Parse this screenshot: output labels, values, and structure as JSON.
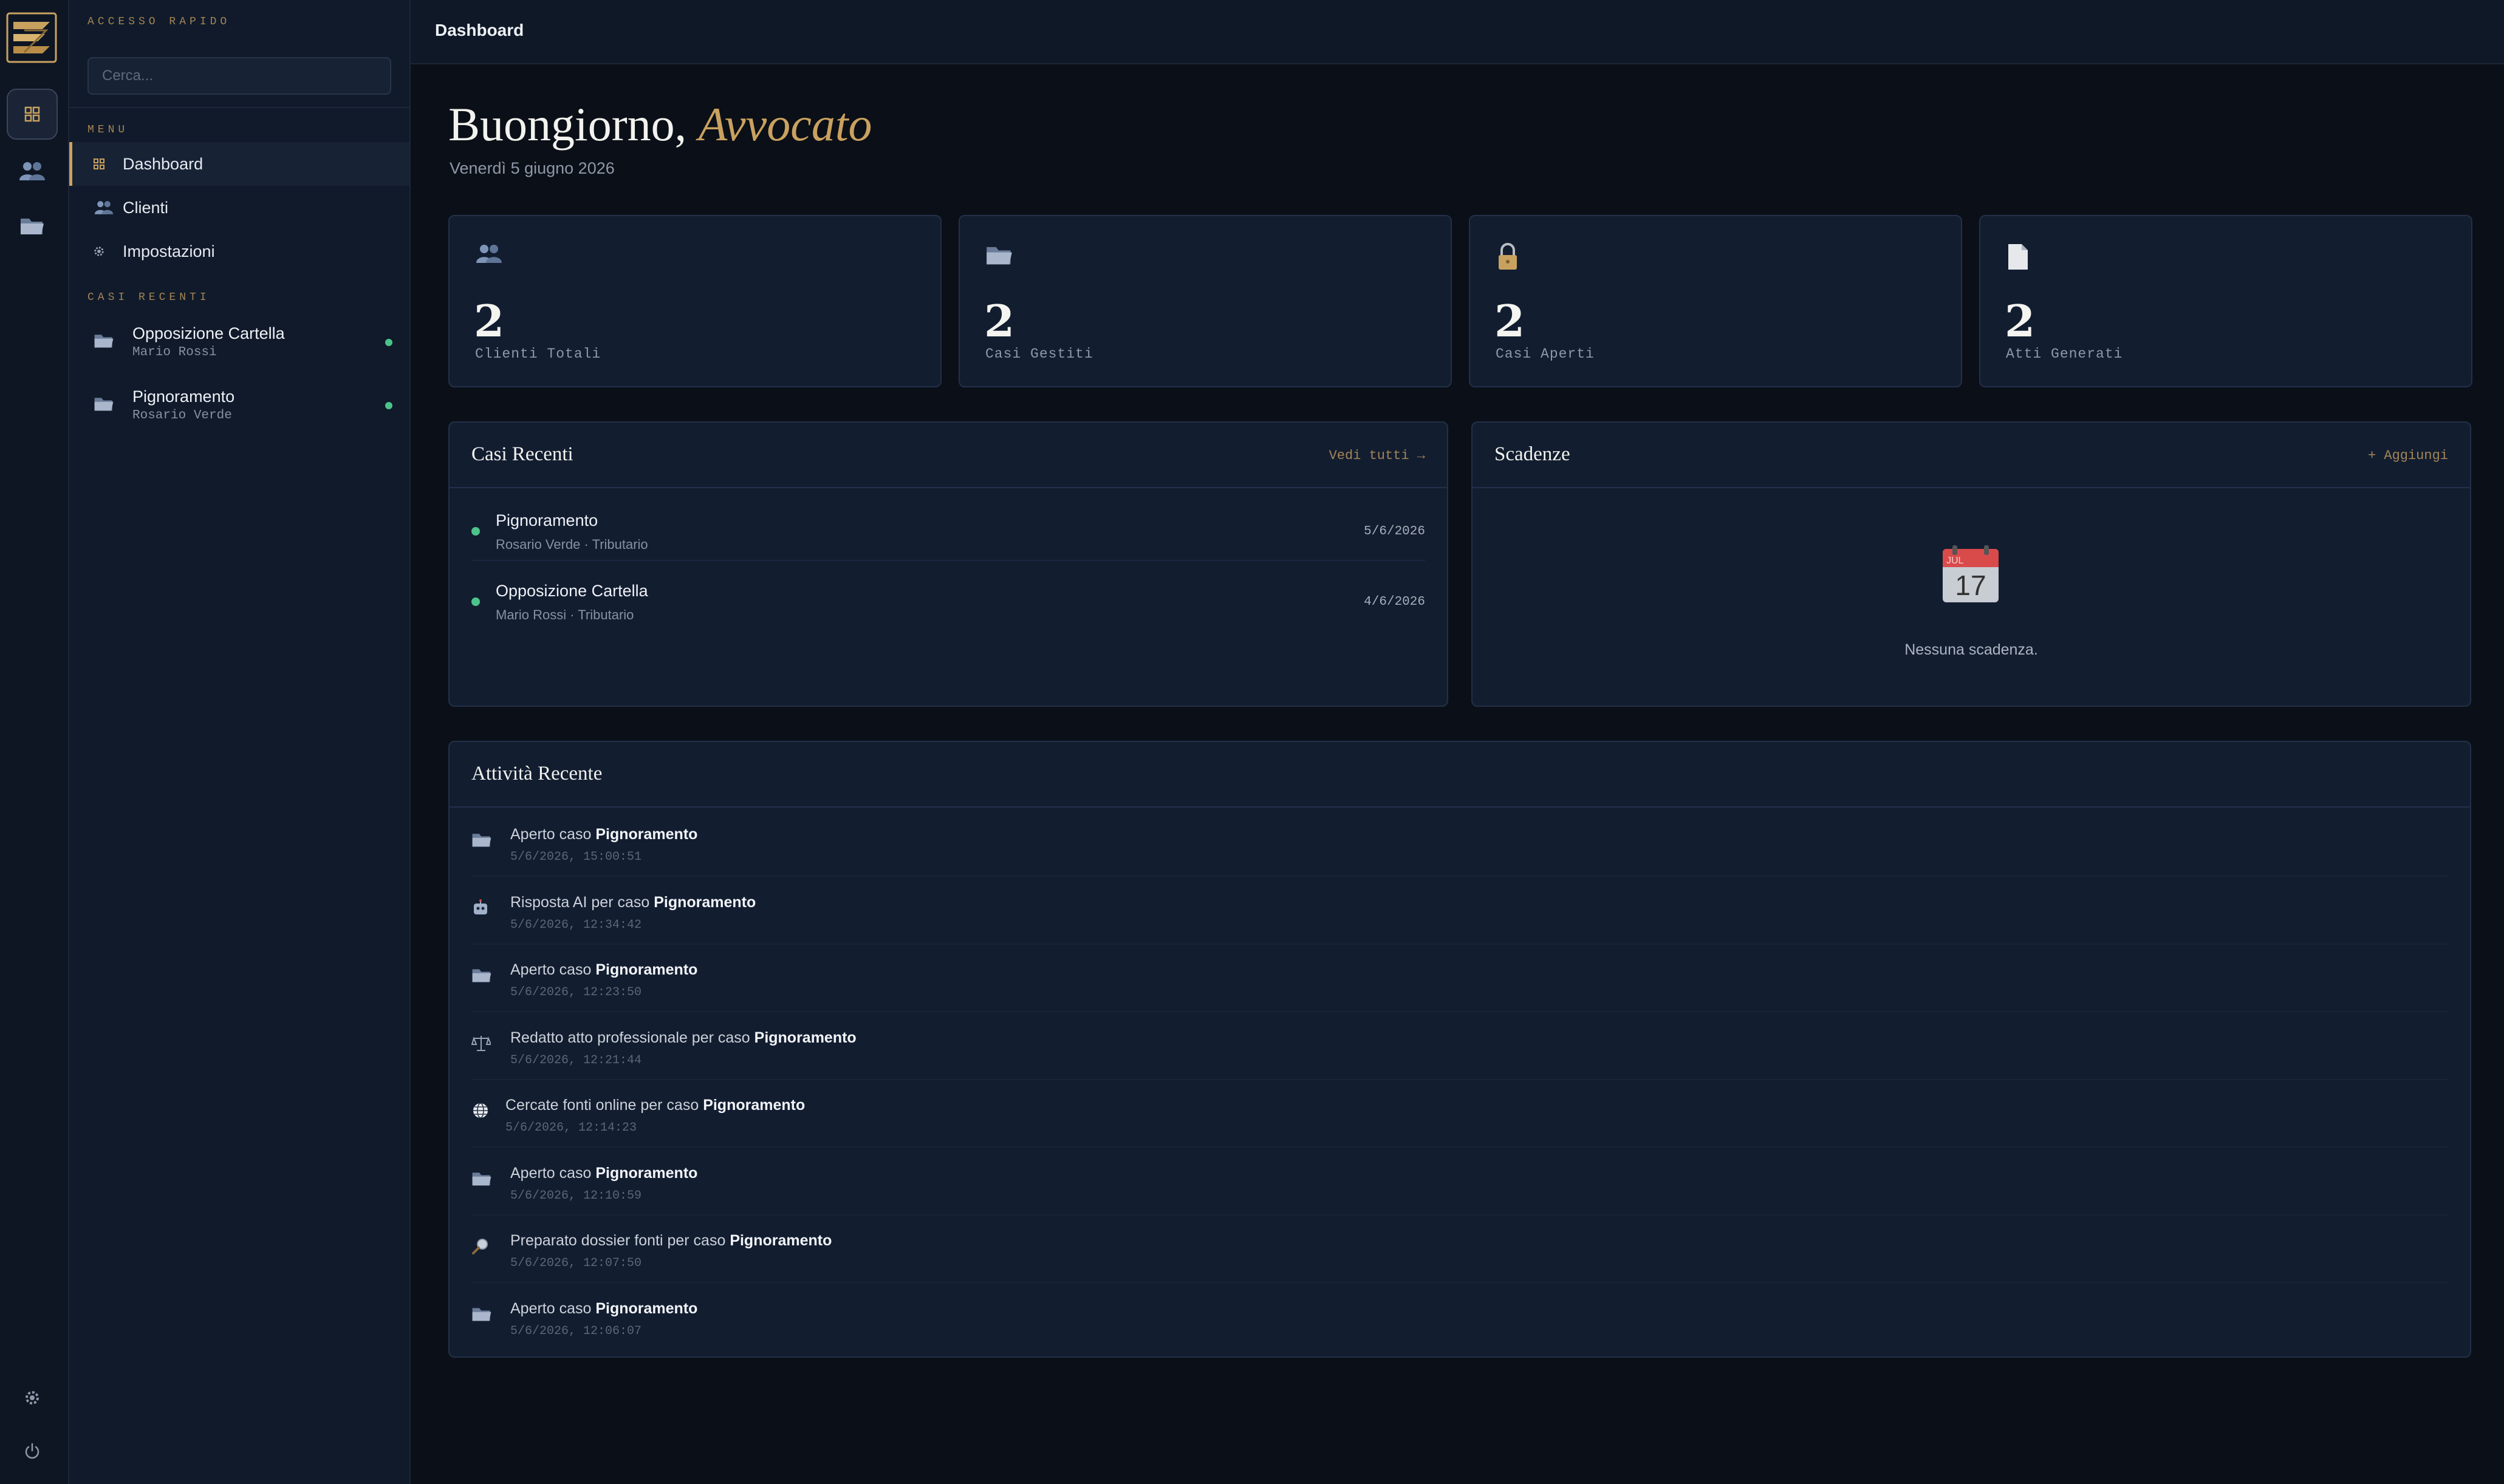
{
  "rail": {
    "icons": [
      "logo-icon",
      "dashboard-icon",
      "clients-icon",
      "folder-icon",
      "settings-icon",
      "power-icon"
    ]
  },
  "sidebar": {
    "quick_access_label": "ACCESSO RAPIDO",
    "search_placeholder": "Cerca...",
    "menu_label": "MENU",
    "menu_items": [
      {
        "label": "Dashboard",
        "icon": "grid-icon",
        "active": true
      },
      {
        "label": "Clienti",
        "icon": "people-icon",
        "active": false
      },
      {
        "label": "Impostazioni",
        "icon": "gear-icon",
        "active": false
      }
    ],
    "recent_cases_label": "CASI RECENTI",
    "recent_cases": [
      {
        "title": "Opposizione Cartella",
        "client": "Mario Rossi"
      },
      {
        "title": "Pignoramento",
        "client": "Rosario Verde"
      }
    ]
  },
  "topbar": {
    "title": "Dashboard"
  },
  "greeting": {
    "prefix": "Buongiorno,",
    "name": "Avvocato",
    "date": "Venerdì 5 giugno 2026"
  },
  "stats": [
    {
      "icon": "people-icon",
      "value": "2",
      "label": "Clienti Totali"
    },
    {
      "icon": "folder-icon",
      "value": "2",
      "label": "Casi Gestiti"
    },
    {
      "icon": "lock-icon",
      "value": "2",
      "label": "Casi Aperti"
    },
    {
      "icon": "document-icon",
      "value": "2",
      "label": "Atti Generati"
    }
  ],
  "recent_cases_panel": {
    "title": "Casi Recenti",
    "link": "Vedi tutti →",
    "rows": [
      {
        "title": "Pignoramento",
        "subtitle": "Rosario Verde · Tributario",
        "date": "5/6/2026"
      },
      {
        "title": "Opposizione Cartella",
        "subtitle": "Mario Rossi · Tributario",
        "date": "4/6/2026"
      }
    ]
  },
  "deadlines_panel": {
    "title": "Scadenze",
    "link": "+ Aggiungi",
    "calendar_month": "JUL",
    "calendar_day": "17",
    "empty_text": "Nessuna scadenza."
  },
  "activity_panel": {
    "title": "Attività Recente",
    "rows": [
      {
        "icon": "folder-icon",
        "text": "Aperto caso ",
        "case": "Pignoramento",
        "timestamp": "5/6/2026, 15:00:51"
      },
      {
        "icon": "robot-icon",
        "text": "Risposta AI per caso ",
        "case": "Pignoramento",
        "timestamp": "5/6/2026, 12:34:42"
      },
      {
        "icon": "folder-icon",
        "text": "Aperto caso ",
        "case": "Pignoramento",
        "timestamp": "5/6/2026, 12:23:50"
      },
      {
        "icon": "scales-icon",
        "text": "Redatto atto professionale per caso ",
        "case": "Pignoramento",
        "timestamp": "5/6/2026, 12:21:44"
      },
      {
        "icon": "globe-icon",
        "text": "Cercate fonti online per caso ",
        "case": "Pignoramento",
        "timestamp": "5/6/2026, 12:14:23"
      },
      {
        "icon": "folder-icon",
        "text": "Aperto caso ",
        "case": "Pignoramento",
        "timestamp": "5/6/2026, 12:10:59"
      },
      {
        "icon": "magnifier-icon",
        "text": "Preparato dossier fonti per caso ",
        "case": "Pignoramento",
        "timestamp": "5/6/2026, 12:07:50"
      },
      {
        "icon": "folder-icon",
        "text": "Aperto caso ",
        "case": "Pignoramento",
        "timestamp": "5/6/2026, 12:06:07"
      }
    ]
  },
  "colors": {
    "accent_gold": "#c9a15f",
    "status_green": "#4cc38a",
    "background": "#0b0f17",
    "panel": "#121d30"
  }
}
